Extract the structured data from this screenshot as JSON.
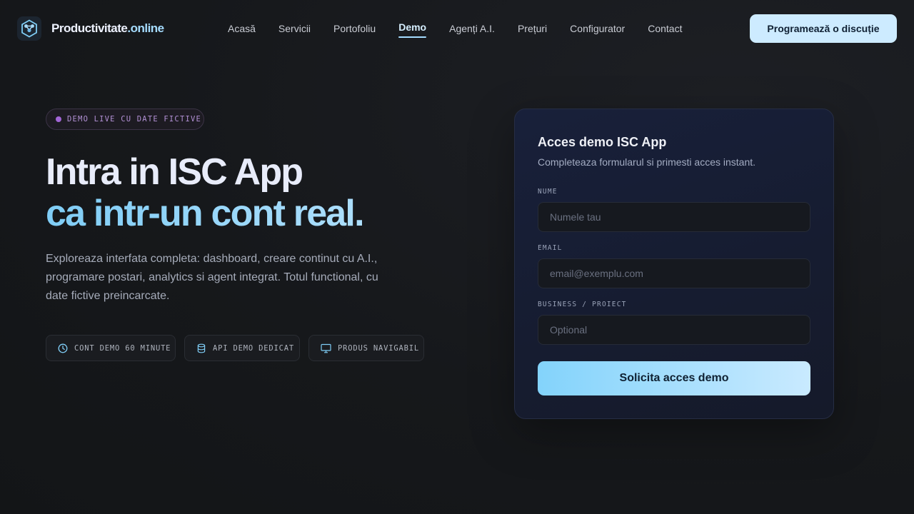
{
  "header": {
    "brand_main": "Productivitate",
    "brand_accent": ".online",
    "nav": [
      {
        "label": "Acasă"
      },
      {
        "label": "Servicii"
      },
      {
        "label": "Portofoliu"
      },
      {
        "label": "Demo"
      },
      {
        "label": "Agenți A.I."
      },
      {
        "label": "Prețuri"
      },
      {
        "label": "Configurator"
      },
      {
        "label": "Contact"
      }
    ],
    "active_nav": "Demo",
    "cta_label": "Programează o discuție"
  },
  "hero": {
    "badge": "DEMO LIVE CU DATE FICTIVE",
    "title_line1": "Intra in ISC App",
    "title_line2": "ca intr-un cont real.",
    "lead": "Exploreaza interfata completa: dashboard, creare continut cu A.I., programare postari, analytics si agent integrat. Totul functional, cu date fictive preincarcate.",
    "pills": [
      {
        "label": "CONT DEMO 60 MINUTE",
        "icon": "clock-icon"
      },
      {
        "label": "API DEMO DEDICAT",
        "icon": "database-icon"
      },
      {
        "label": "PRODUS NAVIGABIL",
        "icon": "monitor-icon"
      }
    ]
  },
  "form": {
    "title": "Acces demo ISC App",
    "subtitle": "Completeaza formularul si primesti acces instant.",
    "fields": [
      {
        "label": "NUME",
        "placeholder": "Numele tau",
        "value": ""
      },
      {
        "label": "EMAIL",
        "placeholder": "email@exemplu.com",
        "value": ""
      },
      {
        "label": "BUSINESS / PROIECT",
        "placeholder": "Optional",
        "value": ""
      }
    ],
    "submit_label": "Solicita acces demo"
  },
  "colors": {
    "accent": "#a5dcff",
    "badge_dot": "#a266d6",
    "background": "#16181b",
    "card": "#18203a"
  }
}
